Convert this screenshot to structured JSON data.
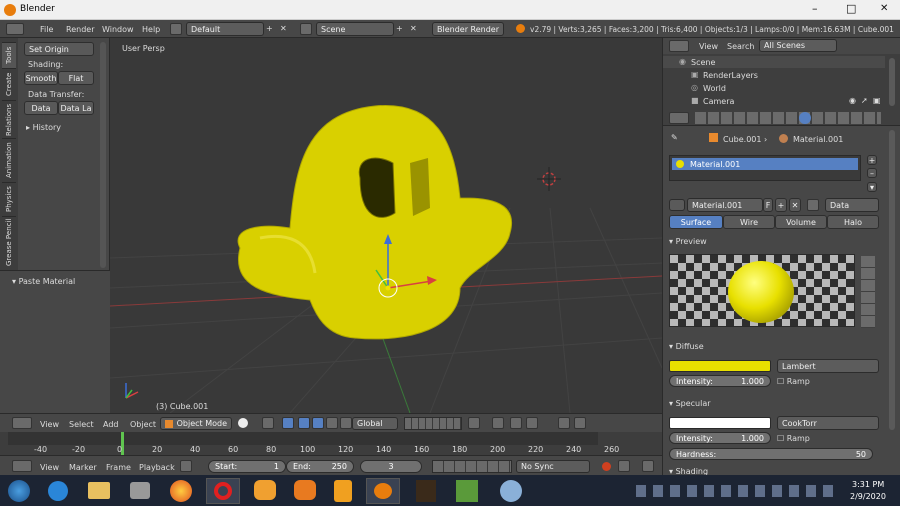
{
  "window": {
    "title": "Blender",
    "min": "–",
    "max": "□",
    "close": "✕"
  },
  "menubar": {
    "items": [
      "File",
      "Render",
      "Window",
      "Help"
    ],
    "layout": "Default",
    "scene": "Scene",
    "engine": "Blender Render",
    "stats": "v2.79 | Verts:3,265 | Faces:3,200 | Tris:6,400 | Objects:1/3 | Lamps:0/0 | Mem:16.63M | Cube.001"
  },
  "tools": {
    "tabs": [
      "Tools",
      "Create",
      "Relations",
      "Animation",
      "Physics",
      "Grease Pencil"
    ],
    "set_origin": "Set Origin",
    "shading_label": "Shading:",
    "smooth": "Smooth",
    "flat": "Flat",
    "data_transfer_label": "Data Transfer:",
    "data": "Data",
    "data_la": "Data La",
    "history": "History",
    "paste_material": "Paste Material"
  },
  "viewport": {
    "label": "User Persp",
    "object_label": "(3) Cube.001"
  },
  "view_header": {
    "view": "View",
    "select": "Select",
    "add": "Add",
    "object": "Object",
    "mode": "Object Mode",
    "orientation": "Global"
  },
  "timeline": {
    "ticks": [
      "-40",
      "-20",
      "0",
      "20",
      "40",
      "60",
      "80",
      "100",
      "120",
      "140",
      "160",
      "180",
      "200",
      "220",
      "240",
      "260"
    ],
    "view": "View",
    "marker": "Marker",
    "frame": "Frame",
    "playback": "Playback",
    "start_label": "Start:",
    "start": "1",
    "end_label": "End:",
    "end": "250",
    "current": "3",
    "sync": "No Sync"
  },
  "outliner": {
    "view": "View",
    "search": "Search",
    "filter": "All Scenes",
    "items": [
      {
        "label": "Scene"
      },
      {
        "label": "RenderLayers"
      },
      {
        "label": "World"
      },
      {
        "label": "Camera"
      }
    ]
  },
  "properties": {
    "breadcrumb_obj": "Cube.001",
    "breadcrumb_mat": "Material.001",
    "slot": "Material.001",
    "mat_name": "Material.001",
    "f": "F",
    "data_link": "Data",
    "tabs": [
      "Surface",
      "Wire",
      "Volume",
      "Halo"
    ],
    "preview": "Preview",
    "diffuse": "Diffuse",
    "diffuse_color": "#e8e000",
    "diffuse_shader": "Lambert",
    "intensity_label": "Intensity:",
    "diffuse_intensity": "1.000",
    "ramp": "Ramp",
    "specular": "Specular",
    "specular_color": "#ffffff",
    "specular_shader": "CookTorr",
    "spec_intensity": "1.000",
    "hardness_label": "Hardness:",
    "hardness": "50",
    "shading": "Shading"
  },
  "taskbar": {
    "time": "3:31 PM",
    "date": "2/9/2020"
  },
  "colors": {
    "accent": "#5680c2",
    "active_tab": "#5680c2",
    "object": "#e8e000"
  }
}
